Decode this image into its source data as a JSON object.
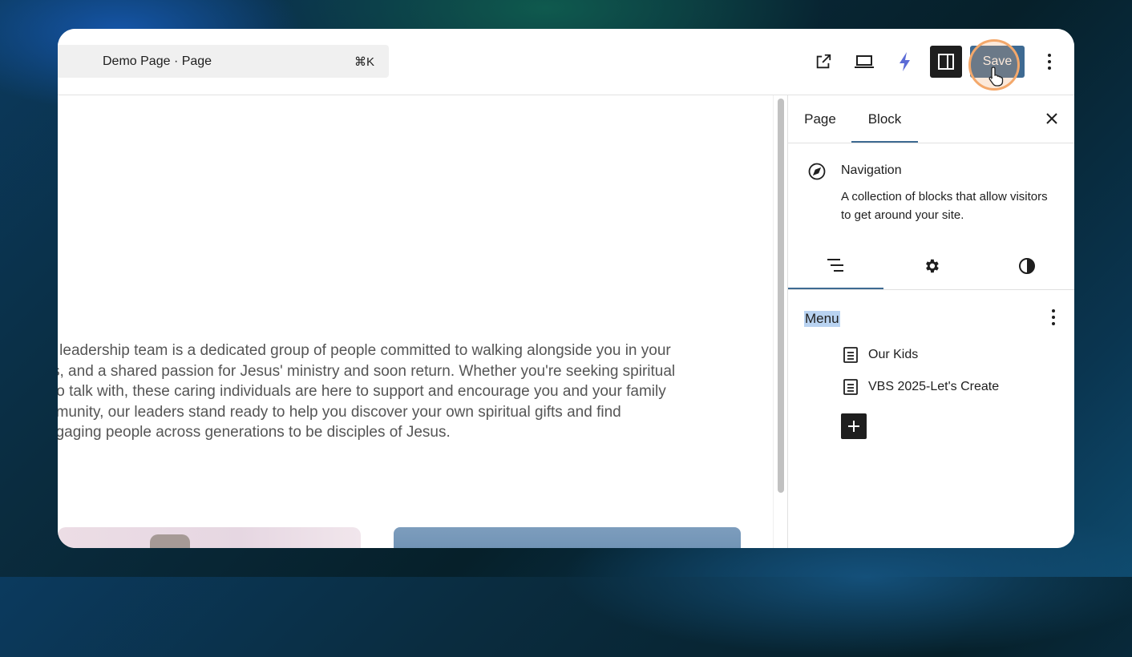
{
  "topbar": {
    "command_title": "Demo Page · Page",
    "command_shortcut": "⌘K",
    "save_label": "Save",
    "icons": [
      "external-link-icon",
      "laptop-preview-icon",
      "lightning-icon",
      "sidebar-toggle-icon",
      "more-vertical-icon"
    ],
    "accent_color": "#3e6a92"
  },
  "canvas": {
    "paragraph_lines": [
      "ur leadership team is a dedicated group of people committed to walking alongside you in your",
      "s, and a shared passion for Jesus' ministry and soon return. Whether you're seeking spiritual",
      "to talk with, these caring individuals are here to support and encourage you and your family",
      "nmunity, our leaders stand ready to help you discover your own spiritual gifts and find",
      "ngaging people across generations to be disciples of Jesus."
    ]
  },
  "sidebar": {
    "tabs": [
      {
        "label": "Page",
        "active": false
      },
      {
        "label": "Block",
        "active": true
      }
    ],
    "block": {
      "name": "Navigation",
      "description": "A collection of blocks that allow visitors to get around your site.",
      "icon": "compass-icon"
    },
    "sub_tabs": [
      "list-view-icon",
      "settings-gear-icon",
      "styles-contrast-icon"
    ],
    "menu": {
      "label": "Menu",
      "items": [
        {
          "label": "Our Kids",
          "icon": "page-icon"
        },
        {
          "label": "VBS 2025-Let's Create",
          "icon": "page-icon"
        }
      ],
      "add_icon": "plus-icon"
    }
  }
}
